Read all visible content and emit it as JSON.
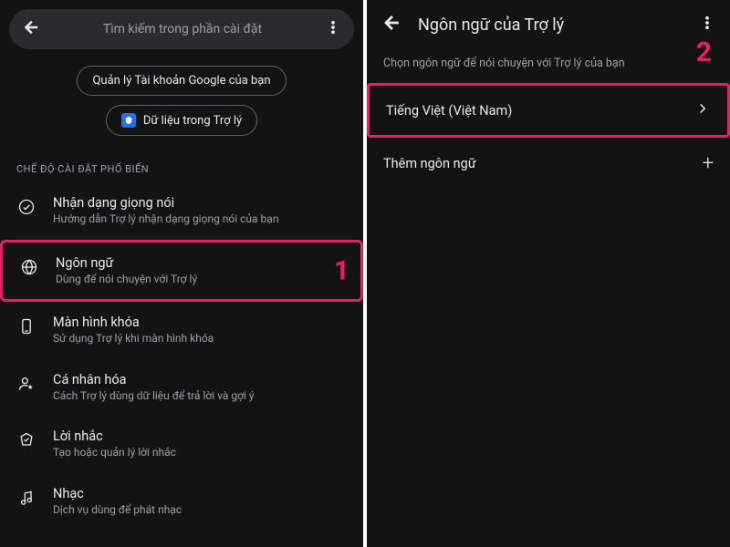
{
  "left": {
    "search_placeholder": "Tìm kiếm trong phần cài đặt",
    "chip_manage_account": "Quản lý Tài khoản Google của bạn",
    "chip_assistant_data": "Dữ liệu trong Trợ lý",
    "section_header": "CHẾ ĐỘ CÀI ĐẶT PHỔ BIẾN",
    "rows": {
      "voice": {
        "title": "Nhận dạng giọng nói",
        "sub": "Hướng dẫn Trợ lý nhận dạng giọng nói của bạn"
      },
      "lang": {
        "title": "Ngôn ngữ",
        "sub": "Dùng để nói chuyện với Trợ lý"
      },
      "lock": {
        "title": "Màn hình khóa",
        "sub": "Sử dụng Trợ lý khi màn hình khóa"
      },
      "pers": {
        "title": "Cá nhân hóa",
        "sub": "Cách Trợ lý dùng dữ liệu để trả lời và gợi ý"
      },
      "remind": {
        "title": "Lời nhắc",
        "sub": "Tạo hoặc quản lý lời nhắc"
      },
      "music": {
        "title": "Nhạc",
        "sub": "Dịch vụ dùng để phát nhạc"
      }
    },
    "callout": "1"
  },
  "right": {
    "title": "Ngôn ngữ của Trợ lý",
    "subtitle": "Chọn ngôn ngữ để nói chuyện với Trợ lý của bạn",
    "lang_primary": "Tiếng Việt (Việt Nam)",
    "add_language": "Thêm ngôn ngữ",
    "callout": "2"
  }
}
